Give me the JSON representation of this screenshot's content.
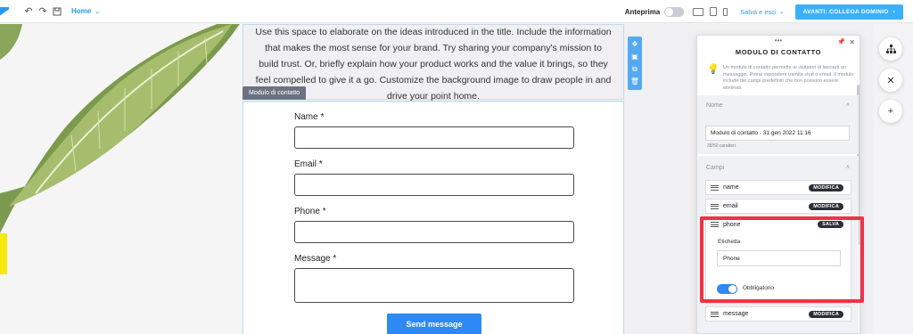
{
  "toolbar": {
    "home_label": "Home",
    "preview_label": "Anteprima",
    "save_label": "Salva e esci",
    "cta_label": "AVANTI: COLLEGA DOMINIO"
  },
  "page": {
    "intro_text": "Use this space to elaborate on the ideas introduced in the title. Include the information that makes the most sense for your brand. Try sharing your company's mission to build trust. Or, briefly explain how your product works and the value it brings, so they feel compelled to give it a go. Customize the background image to draw people in and drive your point home.",
    "form_tag": "Modulo di contatto",
    "form": {
      "fields": [
        {
          "label": "Name *"
        },
        {
          "label": "Email *"
        },
        {
          "label": "Phone *"
        },
        {
          "label": "Message *"
        }
      ],
      "submit_label": "Send message"
    }
  },
  "panel": {
    "title": "MODULO DI CONTATTO",
    "description": "Un modulo di contatto permette ai visitatori di lasciarti un messaggio. Potrai rispondere tramite chat o email. Il modulo include dei campi predefiniti che non possono essere eliminati.",
    "name_section": "Nome",
    "name_value": "Modulo di contatto - 31 gen 2022 11:16",
    "char_count": "38/50 caratteri.",
    "fields_section": "Campi",
    "fields": [
      {
        "name": "name",
        "action": "MODIFICA"
      },
      {
        "name": "email",
        "action": "MODIFICA"
      },
      {
        "name": "phone",
        "action": "SALVA"
      },
      {
        "name": "message",
        "action": "MODIFICA"
      }
    ],
    "phone_editor": {
      "label_title": "Etichetta",
      "label_value": "Phone",
      "required_label": "Obbligatorio",
      "required": true
    }
  },
  "colors": {
    "accent": "#2e88f6",
    "cta": "#3bb0ff",
    "highlight": "#ee3344"
  }
}
